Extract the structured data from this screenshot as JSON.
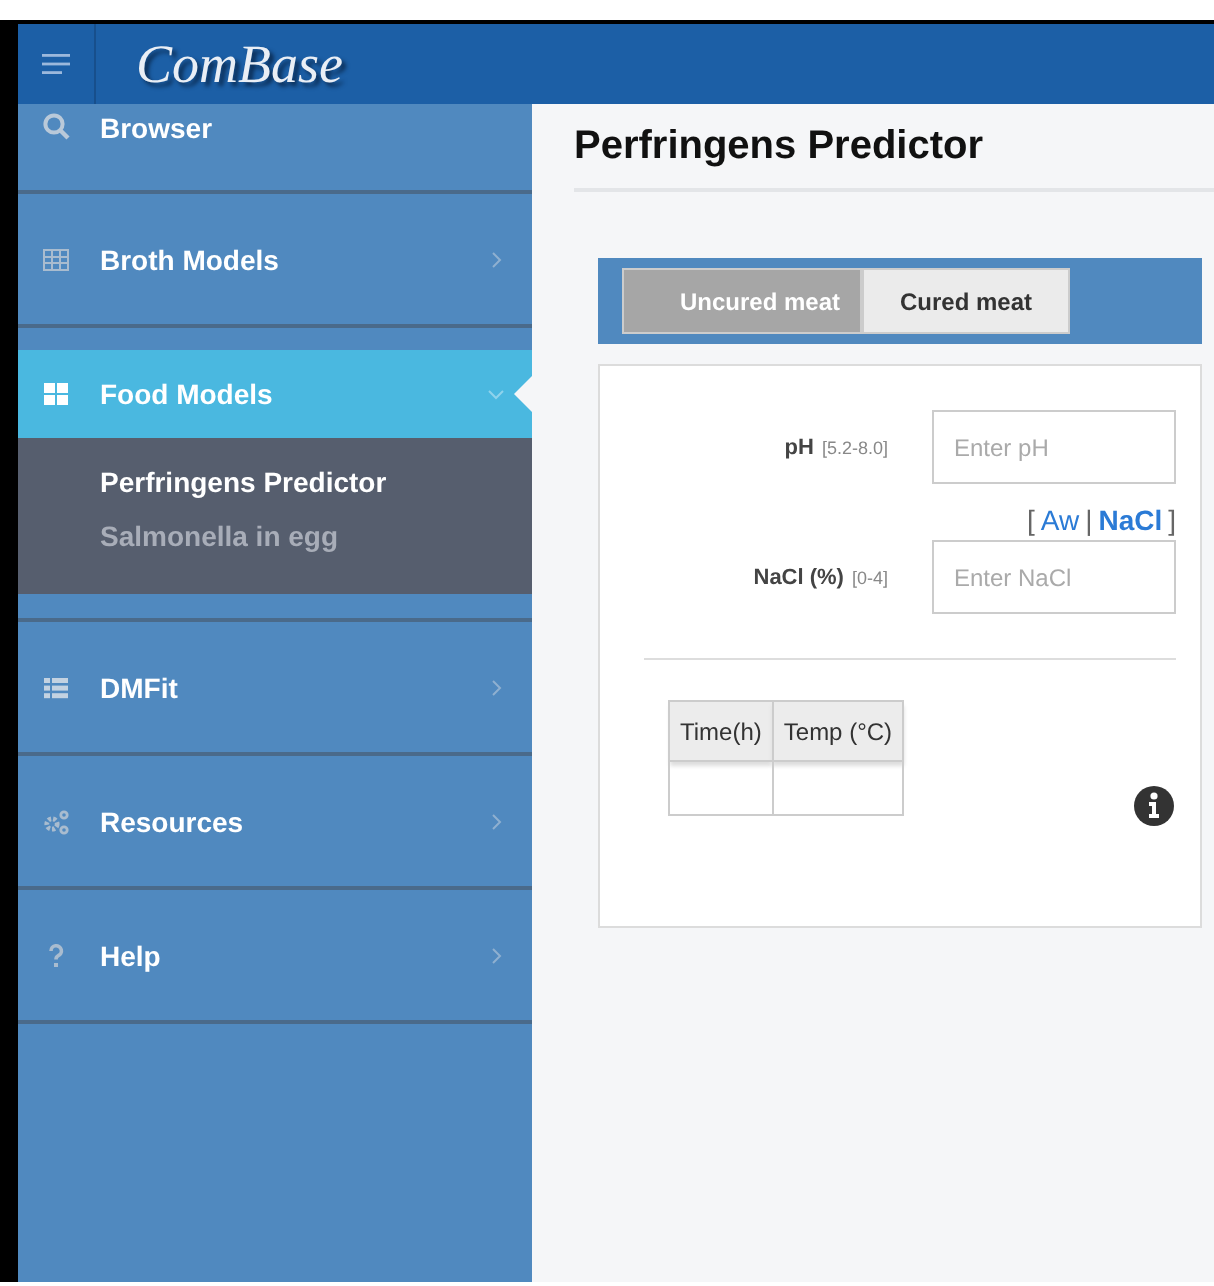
{
  "header": {
    "logo": "ComBase"
  },
  "sidebar": {
    "items": [
      {
        "label": "Browser",
        "has_submenu": false,
        "expanded": false,
        "selected": false
      },
      {
        "label": "Broth Models",
        "has_submenu": true,
        "expanded": false,
        "selected": false
      },
      {
        "label": "Food Models",
        "has_submenu": true,
        "expanded": true,
        "selected": true,
        "children": [
          {
            "label": "Perfringens Predictor",
            "selected": true
          },
          {
            "label": "Salmonella in egg",
            "selected": false
          }
        ]
      },
      {
        "label": "DMFit",
        "has_submenu": true,
        "expanded": false,
        "selected": false
      },
      {
        "label": "Resources",
        "has_submenu": true,
        "expanded": false,
        "selected": false
      },
      {
        "label": "Help",
        "has_submenu": true,
        "expanded": false,
        "selected": false
      }
    ]
  },
  "page": {
    "title": "Perfringens Predictor",
    "tabs": [
      {
        "label": "Uncured meat",
        "selected": true
      },
      {
        "label": "Cured meat",
        "selected": false
      }
    ],
    "fields": [
      {
        "label": "pH",
        "range": "[5.2-8.0]",
        "placeholder": "Enter pH"
      },
      {
        "label": "NaCl (%)",
        "range": "[0-4]",
        "placeholder": "Enter NaCl"
      }
    ],
    "unit_switch": {
      "open": "[",
      "options": [
        "Aw",
        "NaCl"
      ],
      "separator": "|",
      "close": "]"
    },
    "table": {
      "columns": [
        "Time(h)",
        "Temp (°C)"
      ]
    }
  }
}
